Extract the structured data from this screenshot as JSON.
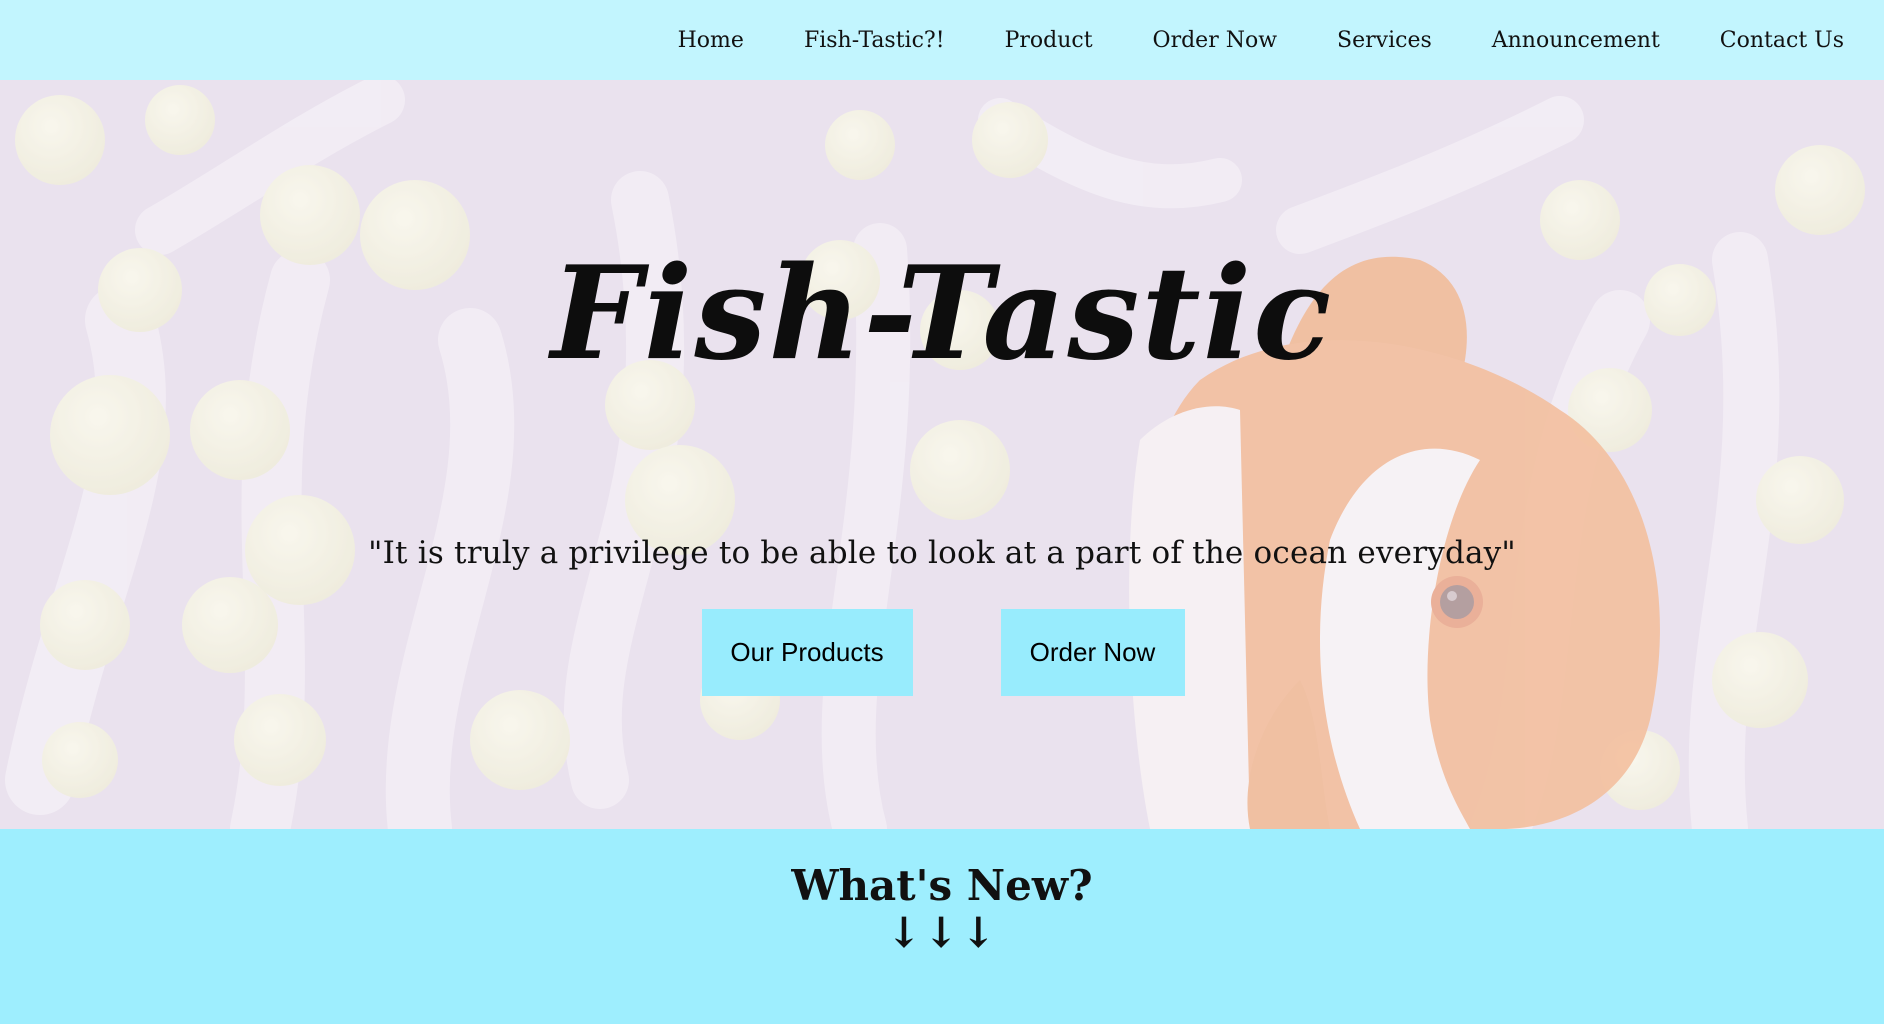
{
  "nav": {
    "items": [
      {
        "label": "Home"
      },
      {
        "label": "Fish-Tastic?!"
      },
      {
        "label": "Product"
      },
      {
        "label": "Order Now"
      },
      {
        "label": "Services"
      },
      {
        "label": "Announcement"
      },
      {
        "label": "Contact Us"
      }
    ]
  },
  "hero": {
    "logo_text": "Fish-Tastic",
    "tagline": "\"It is truly a privilege to be able to look at a part of the ocean everyday\"",
    "buttons": {
      "products_label": "Our Products",
      "order_label": "Order Now"
    },
    "background_image": "clownfish-in-anemone"
  },
  "whats_new": {
    "title": "What's New?",
    "arrows": "↓↓↓"
  },
  "colors": {
    "navbar": "#c2f5fe",
    "button": "#98ecfd",
    "section": "#9eeefe",
    "clownfish_orange": "#f3a470"
  }
}
